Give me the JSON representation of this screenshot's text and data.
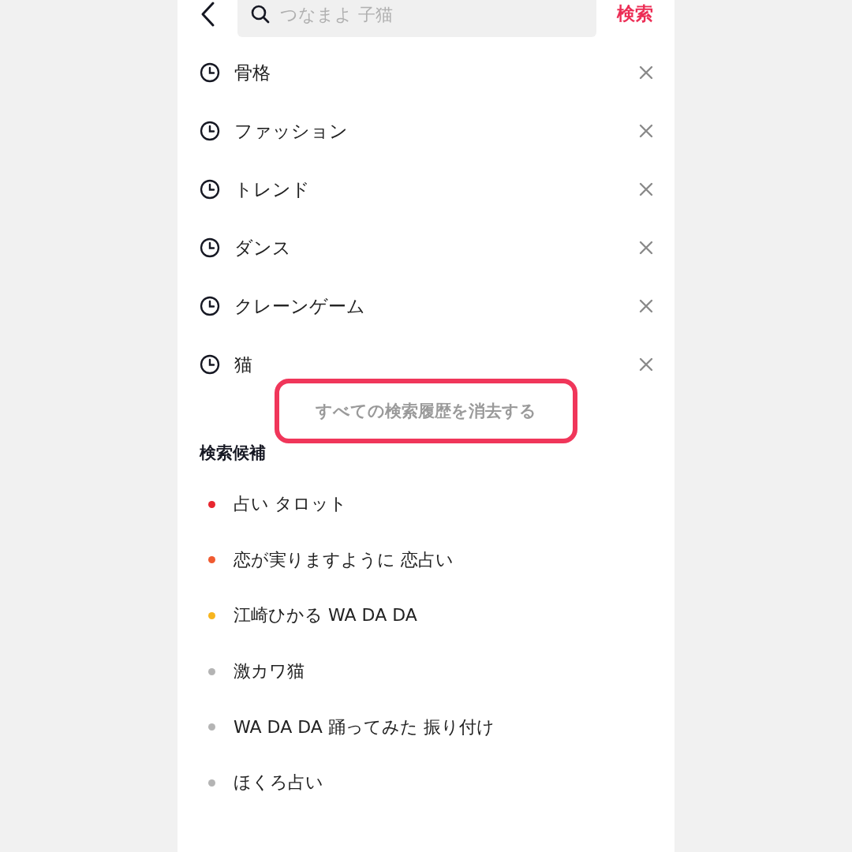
{
  "header": {
    "search": {
      "placeholder": "つなまよ 子猫"
    },
    "search_button": "検索"
  },
  "history": [
    {
      "text": "骨格"
    },
    {
      "text": "ファッション"
    },
    {
      "text": "トレンド"
    },
    {
      "text": "ダンス"
    },
    {
      "text": "クレーンゲーム"
    },
    {
      "text": "猫"
    }
  ],
  "clear_all": {
    "label": "すべての検索履歴を消去する",
    "highlighted": true
  },
  "suggestions": {
    "title": "検索候補",
    "items": [
      {
        "text": "占い タロット",
        "color": "#e8262f"
      },
      {
        "text": "恋が実りますように 恋占い",
        "color": "#f05a30"
      },
      {
        "text": "江崎ひかる WA DA DA",
        "color": "#f7b51e"
      },
      {
        "text": "激カワ猫",
        "color": "#b4b4b4"
      },
      {
        "text": "WA DA DA 踊ってみた 振り付け",
        "color": "#b4b4b4"
      },
      {
        "text": "ほくろ占い",
        "color": "#b4b4b4"
      }
    ]
  }
}
